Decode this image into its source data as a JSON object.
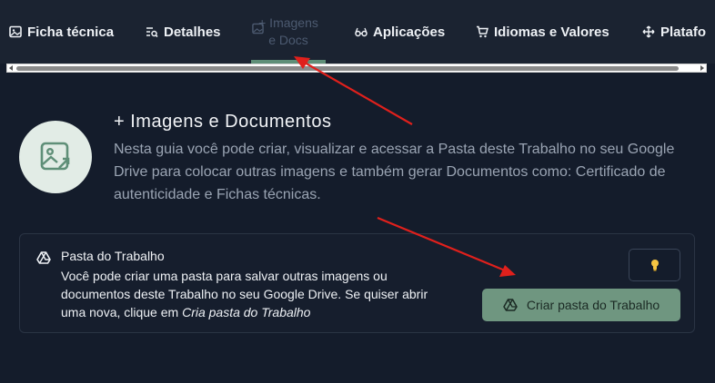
{
  "tabs": [
    {
      "label": "Ficha técnica",
      "icon": "image-file-icon"
    },
    {
      "label": "Detalhes",
      "icon": "list-search-icon"
    },
    {
      "label_line1": "+ Imagens",
      "label_line2": "e Docs",
      "icon": "photo-icon",
      "active": true
    },
    {
      "label": "Aplicações",
      "icon": "glasses-icon"
    },
    {
      "label": "Idiomas e Valores",
      "icon": "cart-icon"
    },
    {
      "label": "Platafo",
      "icon": "move-icon"
    }
  ],
  "hero": {
    "title": "+ Imagens e Documentos",
    "description": "Nesta guia você pode criar, visualizar e acessar a Pasta deste Trabalho no seu Google Drive para colocar outras imagens e também gerar Documentos como: Certificado de autenticidade e Fichas técnicas."
  },
  "card": {
    "title": "Pasta do Trabalho",
    "text": "Você pode criar uma pasta para salvar outras imagens ou documentos deste Trabalho no seu Google Drive. Se quiser abrir uma nova, clique em ",
    "text_italic": "Cria pasta do Trabalho",
    "button_label": "Criar pasta do Trabalho",
    "hint_icon": "lightbulb-icon"
  },
  "colors": {
    "background": "#141c2b",
    "tabbar": "#1b2331",
    "accent": "#6f9680",
    "annotation": "#e0201c"
  }
}
